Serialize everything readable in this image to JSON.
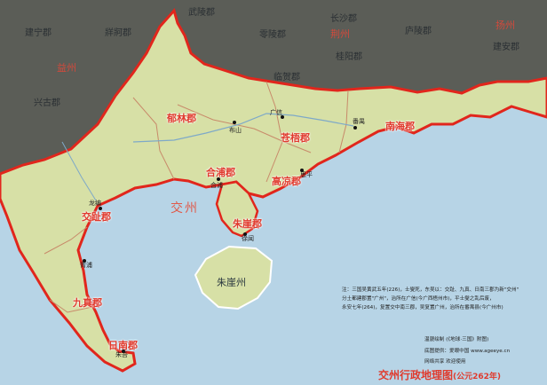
{
  "title": "交州行政地理图",
  "title_year": "(公元262年)",
  "outside_regions": [
    "武陵郡",
    "建宁郡",
    "牂牁郡",
    "零陵郡",
    "桂阳郡",
    "庐陵郡",
    "兴古郡",
    "临贺郡",
    "建安郡",
    "长沙郡"
  ],
  "outside_regions_red": [
    "荆州",
    "扬州",
    "益州"
  ],
  "provinces": [
    "郁林郡",
    "苍梧郡",
    "南海郡",
    "合浦郡",
    "高凉郡",
    "交趾郡",
    "朱崖郡",
    "九真郡",
    "日南郡"
  ],
  "sea_label": "交州",
  "island_label": "朱崖州",
  "cities": [
    "广信",
    "番禺",
    "布山",
    "合浦",
    "思平",
    "龙编",
    "徐闻",
    "胥浦",
    "朱吾"
  ],
  "notes": [
    "注：三国吴黄武五年(226)，士燮死，东吴以：交趾、九真、日南三郡为新\"交州\"",
    "分土都建郡置\"广州\"，治所在广信(今广西梧州市)，平士燮之乱后废，",
    "永安七年(264)，复置交中南三郡，吴复置广州，治所在番禺县(今广州市)"
  ],
  "credits": [
    "温骁绘制 (《地球·三国》附图)",
    "底图提供：爱眼中国  www.ageeye.cn",
    "网络共享  欢迎使用"
  ],
  "colors": {
    "land": "#d7e0a6",
    "sea": "#b7d4e6",
    "outside": "#5b5d57",
    "border": "#e1261c",
    "label": "#e03a2d"
  }
}
